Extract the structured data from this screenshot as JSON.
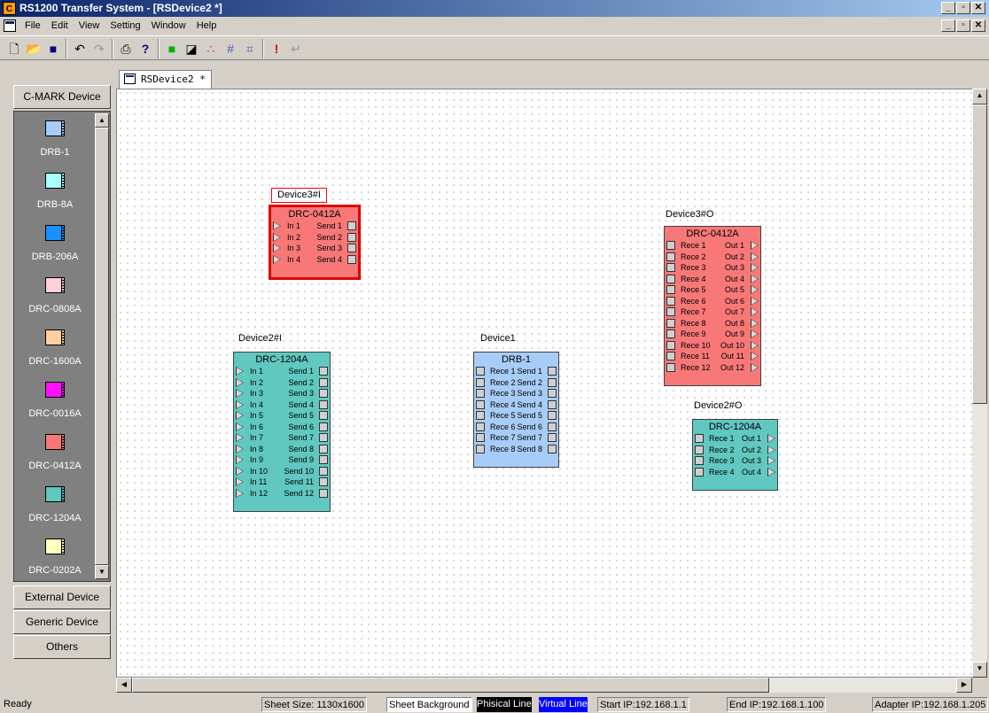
{
  "window": {
    "title": "RS1200 Transfer System - [RSDevice2 *]",
    "app_icon": "C"
  },
  "menu": [
    "File",
    "Edit",
    "View",
    "Setting",
    "Window",
    "Help"
  ],
  "document_tab": "RSDevice2 *",
  "toolbar": {
    "icons": [
      "new-file-icon",
      "open-folder-icon",
      "save-icon",
      "undo-icon",
      "redo-icon",
      "print-icon",
      "help-icon",
      "select-rect-icon",
      "draw-line-icon",
      "color-dots-icon",
      "grid-icon",
      "align-icon",
      "alert-icon",
      "enter-icon"
    ]
  },
  "left_panel": {
    "top_category": "C-MARK Device",
    "items": [
      {
        "label": "DRB-1",
        "color": "#a8ccf8"
      },
      {
        "label": "DRB-8A",
        "color": "#a8ffff"
      },
      {
        "label": "DRB-206A",
        "color": "#1890ff"
      },
      {
        "label": "DRC-0808A",
        "color": "#ffd0d8"
      },
      {
        "label": "DRC-1600A",
        "color": "#ffd0a0"
      },
      {
        "label": "DRC-0016A",
        "color": "#ff10ff"
      },
      {
        "label": "DRC-0412A",
        "color": "#f87878"
      },
      {
        "label": "DRC-1204A",
        "color": "#60c8c0"
      },
      {
        "label": "DRC-0202A",
        "color": "#ffffc0"
      }
    ],
    "bottom_categories": [
      "External Device",
      "Generic Device",
      "Others"
    ]
  },
  "devices": [
    {
      "id": "d3i",
      "label": "Device3#I",
      "model": "DRC-0412A",
      "color": "#f87878",
      "selected": true,
      "left_type": "in",
      "right_type": "send",
      "ports": [
        [
          "In 1",
          "Send 1"
        ],
        [
          "In 2",
          "Send 2"
        ],
        [
          "In 3",
          "Send 3"
        ],
        [
          "In 4",
          "Send 4"
        ]
      ]
    },
    {
      "id": "d3o",
      "label": "Device3#O",
      "model": "DRC-0412A",
      "color": "#f87878",
      "selected": false,
      "left_type": "rece",
      "right_type": "out",
      "ports": [
        [
          "Rece 1",
          "Out 1"
        ],
        [
          "Rece 2",
          "Out 2"
        ],
        [
          "Rece 3",
          "Out 3"
        ],
        [
          "Rece 4",
          "Out 4"
        ],
        [
          "Rece 5",
          "Out 5"
        ],
        [
          "Rece 6",
          "Out 6"
        ],
        [
          "Rece 7",
          "Out 7"
        ],
        [
          "Rece 8",
          "Out 8"
        ],
        [
          "Rece 9",
          "Out 9"
        ],
        [
          "Rece 10",
          "Out 10"
        ],
        [
          "Rece 11",
          "Out 11"
        ],
        [
          "Rece 12",
          "Out 12"
        ]
      ]
    },
    {
      "id": "d2i",
      "label": "Device2#I",
      "model": "DRC-1204A",
      "color": "#60c8c0",
      "selected": false,
      "left_type": "in",
      "right_type": "send",
      "ports": [
        [
          "In 1",
          "Send 1"
        ],
        [
          "In 2",
          "Send 2"
        ],
        [
          "In 3",
          "Send 3"
        ],
        [
          "In 4",
          "Send 4"
        ],
        [
          "In 5",
          "Send 5"
        ],
        [
          "In 6",
          "Send 6"
        ],
        [
          "In 7",
          "Send 7"
        ],
        [
          "In 8",
          "Send 8"
        ],
        [
          "In 9",
          "Send 9"
        ],
        [
          "In 10",
          "Send 10"
        ],
        [
          "In 11",
          "Send 11"
        ],
        [
          "In 12",
          "Send 12"
        ]
      ]
    },
    {
      "id": "d1",
      "label": "Device1",
      "model": "DRB-1",
      "color": "#a8ccf8",
      "selected": false,
      "left_type": "rece",
      "right_type": "send",
      "ports": [
        [
          "Rece 1",
          "Send 1"
        ],
        [
          "Rece 2",
          "Send 2"
        ],
        [
          "Rece 3",
          "Send 3"
        ],
        [
          "Rece 4",
          "Send 4"
        ],
        [
          "Rece 5",
          "Send 5"
        ],
        [
          "Rece 6",
          "Send 6"
        ],
        [
          "Rece 7",
          "Send 7"
        ],
        [
          "Rece 8",
          "Send 8"
        ]
      ]
    },
    {
      "id": "d2o",
      "label": "Device2#O",
      "model": "DRC-1204A",
      "color": "#60c8c0",
      "selected": false,
      "left_type": "rece",
      "right_type": "out",
      "ports": [
        [
          "Rece 1",
          "Out 1"
        ],
        [
          "Rece 2",
          "Out 2"
        ],
        [
          "Rece 3",
          "Out 3"
        ],
        [
          "Rece 4",
          "Out 4"
        ]
      ]
    }
  ],
  "status": {
    "ready": "Ready",
    "sheet_size": "Sheet Size: 1130x1600",
    "sheet_background": "Sheet Background",
    "physical_line": "Phisical Line",
    "virtual_line": "Virtual Line",
    "start_ip": "Start IP:192.168.1.1",
    "end_ip": "End IP:192.168.1.100",
    "adapter_ip": "Adapter IP:192.168.1.205",
    "physical_line_color": "#000000",
    "virtual_line_color": "#0000ff"
  }
}
